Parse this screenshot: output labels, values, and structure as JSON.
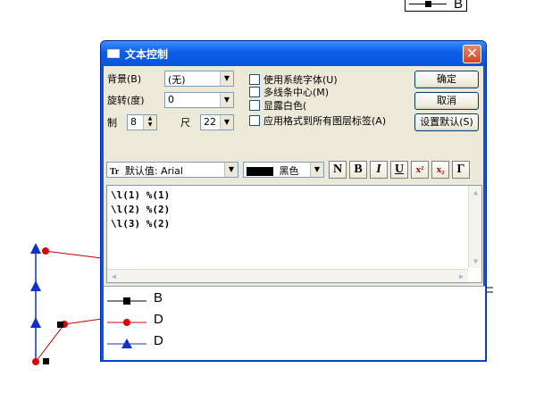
{
  "background": {
    "legend_label": "B"
  },
  "dialog": {
    "title": "文本控制",
    "close_glyph": "✕",
    "background_label": "背景(B)",
    "background_value": "(无)",
    "rotate_label": "旋转(度)",
    "rotate_value": "0",
    "size_prefix": "制",
    "size_value": "8",
    "ruler_label": "尺",
    "ruler_value": "22",
    "checkboxes": [
      "使用系统字体(U)",
      "多线条中心(M)",
      "显露白色(",
      "应用格式到所有图层标签(A)"
    ],
    "ok_label": "确定",
    "cancel_label": "取消",
    "set_default_label": "设置默认(S)",
    "font_value": "默认值: Arial",
    "color_value": "黑色",
    "format_buttons": [
      "N",
      "B",
      "I",
      "U",
      "x²",
      "x₂",
      "Γ"
    ],
    "text_lines": [
      "\\l(1) %(1)",
      "\\l(2) %(2)",
      "\\l(3) %(2)"
    ],
    "preview": [
      {
        "symbol": "square",
        "color": "#000000",
        "label": "B"
      },
      {
        "symbol": "circle",
        "color": "#e00000",
        "label": "D"
      },
      {
        "symbol": "triangle",
        "color": "#1030c8",
        "label": "D"
      }
    ]
  },
  "colors": {
    "title_bar": "#0a54e0",
    "dialog_face": "#ece9d8",
    "close_button": "#d4431f"
  }
}
